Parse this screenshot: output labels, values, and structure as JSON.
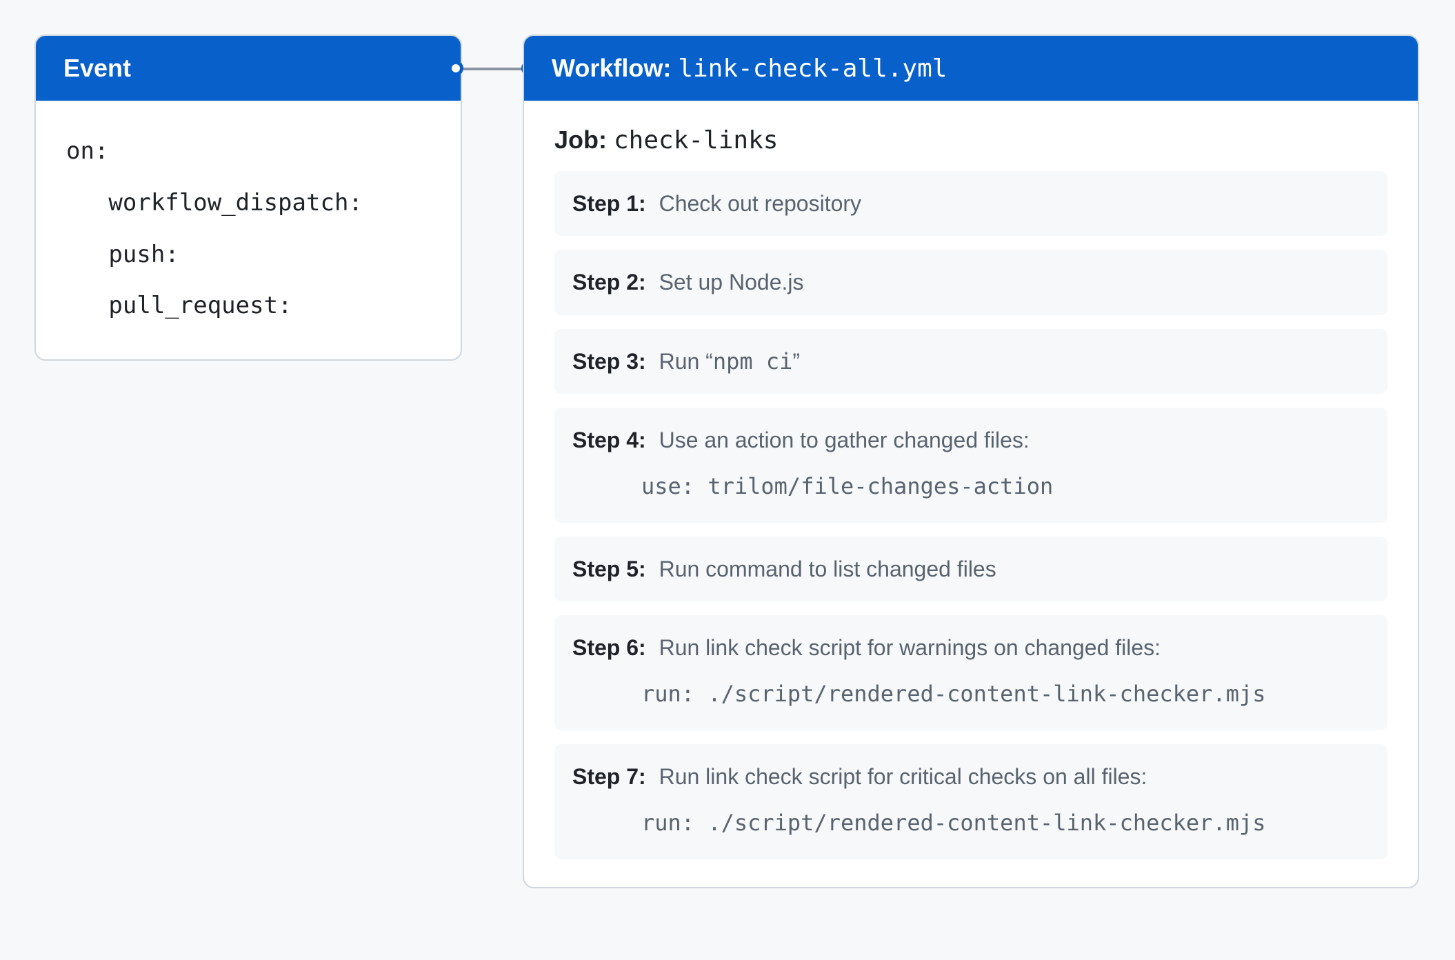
{
  "event": {
    "header": "Event",
    "on_label": "on:",
    "triggers": [
      "workflow_dispatch:",
      "push:",
      "pull_request:"
    ]
  },
  "workflow": {
    "header_prefix": "Workflow: ",
    "filename": "link-check-all.yml",
    "job_label": "Job: ",
    "job_name": "check-links",
    "steps": [
      {
        "label": "Step 1:",
        "text": "Check out repository"
      },
      {
        "label": "Step 2:",
        "text": "Set up Node.js"
      },
      {
        "label": "Step 3:",
        "text_prefix": "Run “",
        "text_mono": "npm ci",
        "text_suffix": "”"
      },
      {
        "label": "Step 4:",
        "text": "Use an action to gather changed files:",
        "sub": "use: trilom/file-changes-action"
      },
      {
        "label": "Step 5:",
        "text": "Run command to list changed files"
      },
      {
        "label": "Step 6:",
        "text": "Run link check script for warnings on changed files:",
        "sub": "run: ./script/rendered-content-link-checker.mjs"
      },
      {
        "label": "Step 7:",
        "text": "Run link check script for critical checks on all files:",
        "sub": "run: ./script/rendered-content-link-checker.mjs"
      }
    ]
  }
}
